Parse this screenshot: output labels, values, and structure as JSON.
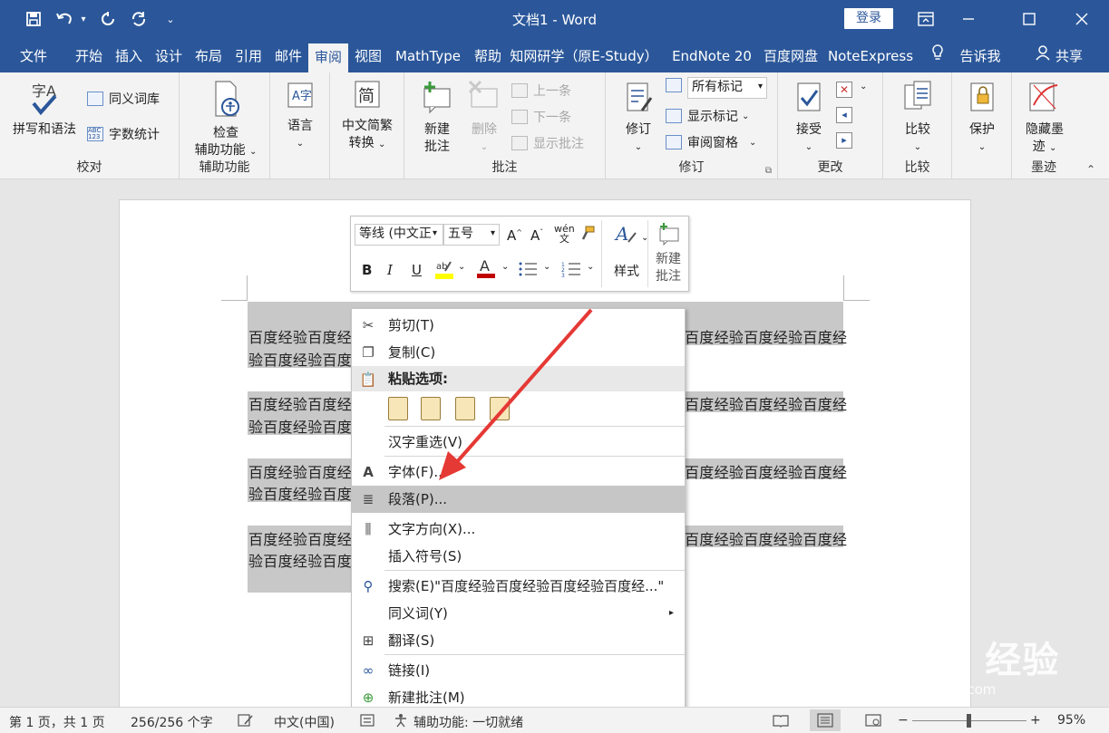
{
  "titlebar": {
    "title": "文档1 - Word",
    "login_label": "登录"
  },
  "tabs": [
    "文件",
    "开始",
    "插入",
    "设计",
    "布局",
    "引用",
    "邮件",
    "审阅",
    "视图",
    "MathType",
    "帮助",
    "知网研学（原E-Study）",
    "EndNote 20",
    "百度网盘",
    "NoteExpress",
    "告诉我",
    "共享"
  ],
  "ribbon": {
    "proof": {
      "spell": "拼写和语法",
      "thesaurus": "同义词库",
      "wordcount": "字数统计",
      "label": "校对"
    },
    "access": {
      "check_line1": "检查",
      "check_line2": "辅助功能",
      "label": "辅助功能"
    },
    "lang": {
      "language": "语言",
      "label": ""
    },
    "chinese": {
      "line1": "中文简繁",
      "line2": "转换",
      "glyph": "简"
    },
    "comments": {
      "new_line1": "新建",
      "new_line2": "批注",
      "delete": "删除",
      "prev": "上一条",
      "next": "下一条",
      "show": "显示批注",
      "label": "批注"
    },
    "tracking": {
      "track": "修订",
      "markup_value": "所有标记",
      "show_markup": "显示标记",
      "review_pane": "审阅窗格",
      "label": "修订"
    },
    "changes": {
      "accept": "接受",
      "label": "更改"
    },
    "compare": {
      "compare": "比较",
      "label": "比较"
    },
    "protect": {
      "protect": "保护",
      "label": ""
    },
    "ink": {
      "hide_line1": "隐藏墨",
      "hide_line2": "迹",
      "label": "墨迹"
    }
  },
  "document": {
    "left_line1": "百度经验百度经",
    "left_line2": "验百度经验百度",
    "right_line1": "百度经验百度经验百度经",
    "paragraphs": 4
  },
  "minitoolbar": {
    "font": "等线 (中文正",
    "size": "五号",
    "styles": "样式",
    "new_comment_line1": "新建",
    "new_comment_line2": "批注",
    "font_color": "#c00000",
    "highlight_color": "#ffff00"
  },
  "context_menu": {
    "cut": "剪切(T)",
    "copy": "复制(C)",
    "paste_header": "粘贴选项:",
    "reconvert": "汉字重选(V)",
    "font": "字体(F)...",
    "paragraph": "段落(P)...",
    "text_direction": "文字方向(X)...",
    "insert_symbol": "插入符号(S)",
    "search": "搜索(E)\"百度经验百度经验百度经验百度经...\"",
    "synonyms": "同义词(Y)",
    "translate": "翻译(S)",
    "link": "链接(I)",
    "new_comment": "新建批注(M)"
  },
  "statusbar": {
    "page": "第 1 页，共 1 页",
    "words": "256/256 个字",
    "language": "中文(中国)",
    "accessibility": "辅助功能: 一切就绪",
    "zoom": "95%"
  },
  "watermark": {
    "brand": "Baidu 经验",
    "url": "jingyan.baidu.com"
  },
  "colors": {
    "accent": "#2b579a",
    "arrow": "#e53935"
  }
}
